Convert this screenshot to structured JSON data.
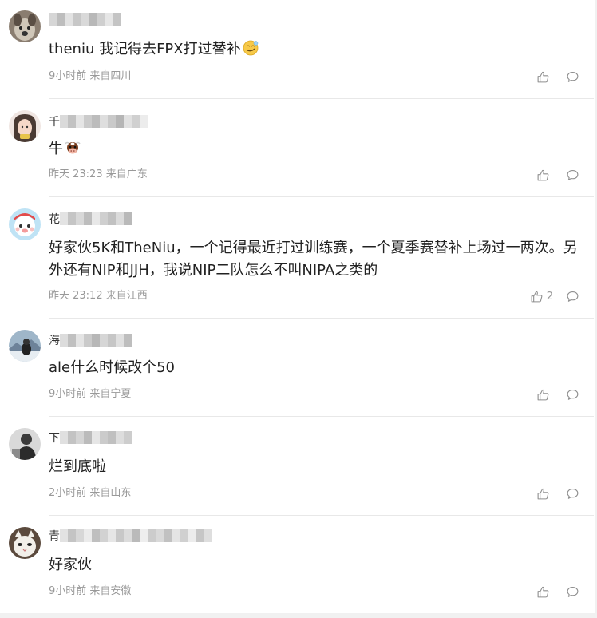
{
  "comments": [
    {
      "text": "theniu 我记得去FPX打过替补",
      "emoji": "smirk-emoji",
      "meta": "9小时前 来自四川",
      "likes": "",
      "avatar": "avatar-dog",
      "name_initial": ""
    },
    {
      "text": "牛",
      "emoji": "cow-emoji",
      "meta": "昨天 23:23 来自广东",
      "likes": "",
      "avatar": "avatar-girl",
      "name_initial": "千"
    },
    {
      "text": "好家伙5K和TheNiu，一个记得最近打过训练赛，一个夏季赛替补上场过一两次。另外还有NIP和JJH，我说NIP二队怎么不叫NIPA之类的",
      "emoji": "",
      "meta": "昨天 23:12 来自江西",
      "likes": "2",
      "avatar": "avatar-cartoon",
      "name_initial": "花"
    },
    {
      "text": "ale什么时候改个50",
      "emoji": "",
      "meta": "9小时前 来自宁夏",
      "likes": "",
      "avatar": "avatar-landscape",
      "name_initial": "海"
    },
    {
      "text": "烂到底啦",
      "emoji": "",
      "meta": "2小时前 来自山东",
      "likes": "",
      "avatar": "avatar-bw",
      "name_initial": "下"
    },
    {
      "text": "好家伙",
      "emoji": "",
      "meta": "9小时前 来自安徽",
      "likes": "",
      "avatar": "avatar-cat",
      "name_initial": "青"
    }
  ]
}
